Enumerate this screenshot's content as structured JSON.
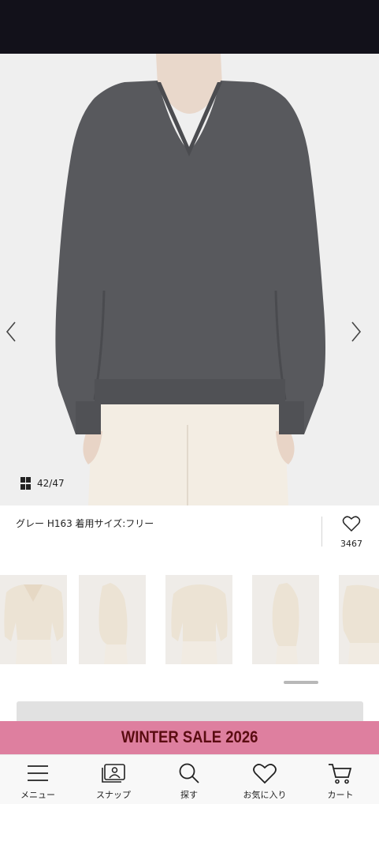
{
  "gallery": {
    "counter_current": "42",
    "counter_total": "47",
    "counter_separator": "/",
    "prev_icon": "chevron-left-icon",
    "next_icon": "chevron-right-icon",
    "grid_icon": "grid-icon"
  },
  "caption": {
    "text": "グレー H163 着用サイズ:フリー",
    "favorite_icon": "heart-icon",
    "favorite_count": "3467"
  },
  "thumbnails": [
    {
      "name": "thumb-front"
    },
    {
      "name": "thumb-side"
    },
    {
      "name": "thumb-back"
    },
    {
      "name": "thumb-side-2"
    },
    {
      "name": "thumb-side-3"
    }
  ],
  "banner": {
    "text": "WINTER SALE 2026",
    "background": "#de7f9f",
    "text_color": "#5a0c11"
  },
  "bottom_nav": [
    {
      "label": "メニュー",
      "icon": "menu-icon"
    },
    {
      "label": "スナップ",
      "icon": "snap-icon"
    },
    {
      "label": "探す",
      "icon": "search-icon"
    },
    {
      "label": "お気に入り",
      "icon": "heart-icon"
    },
    {
      "label": "カート",
      "icon": "cart-icon"
    }
  ]
}
